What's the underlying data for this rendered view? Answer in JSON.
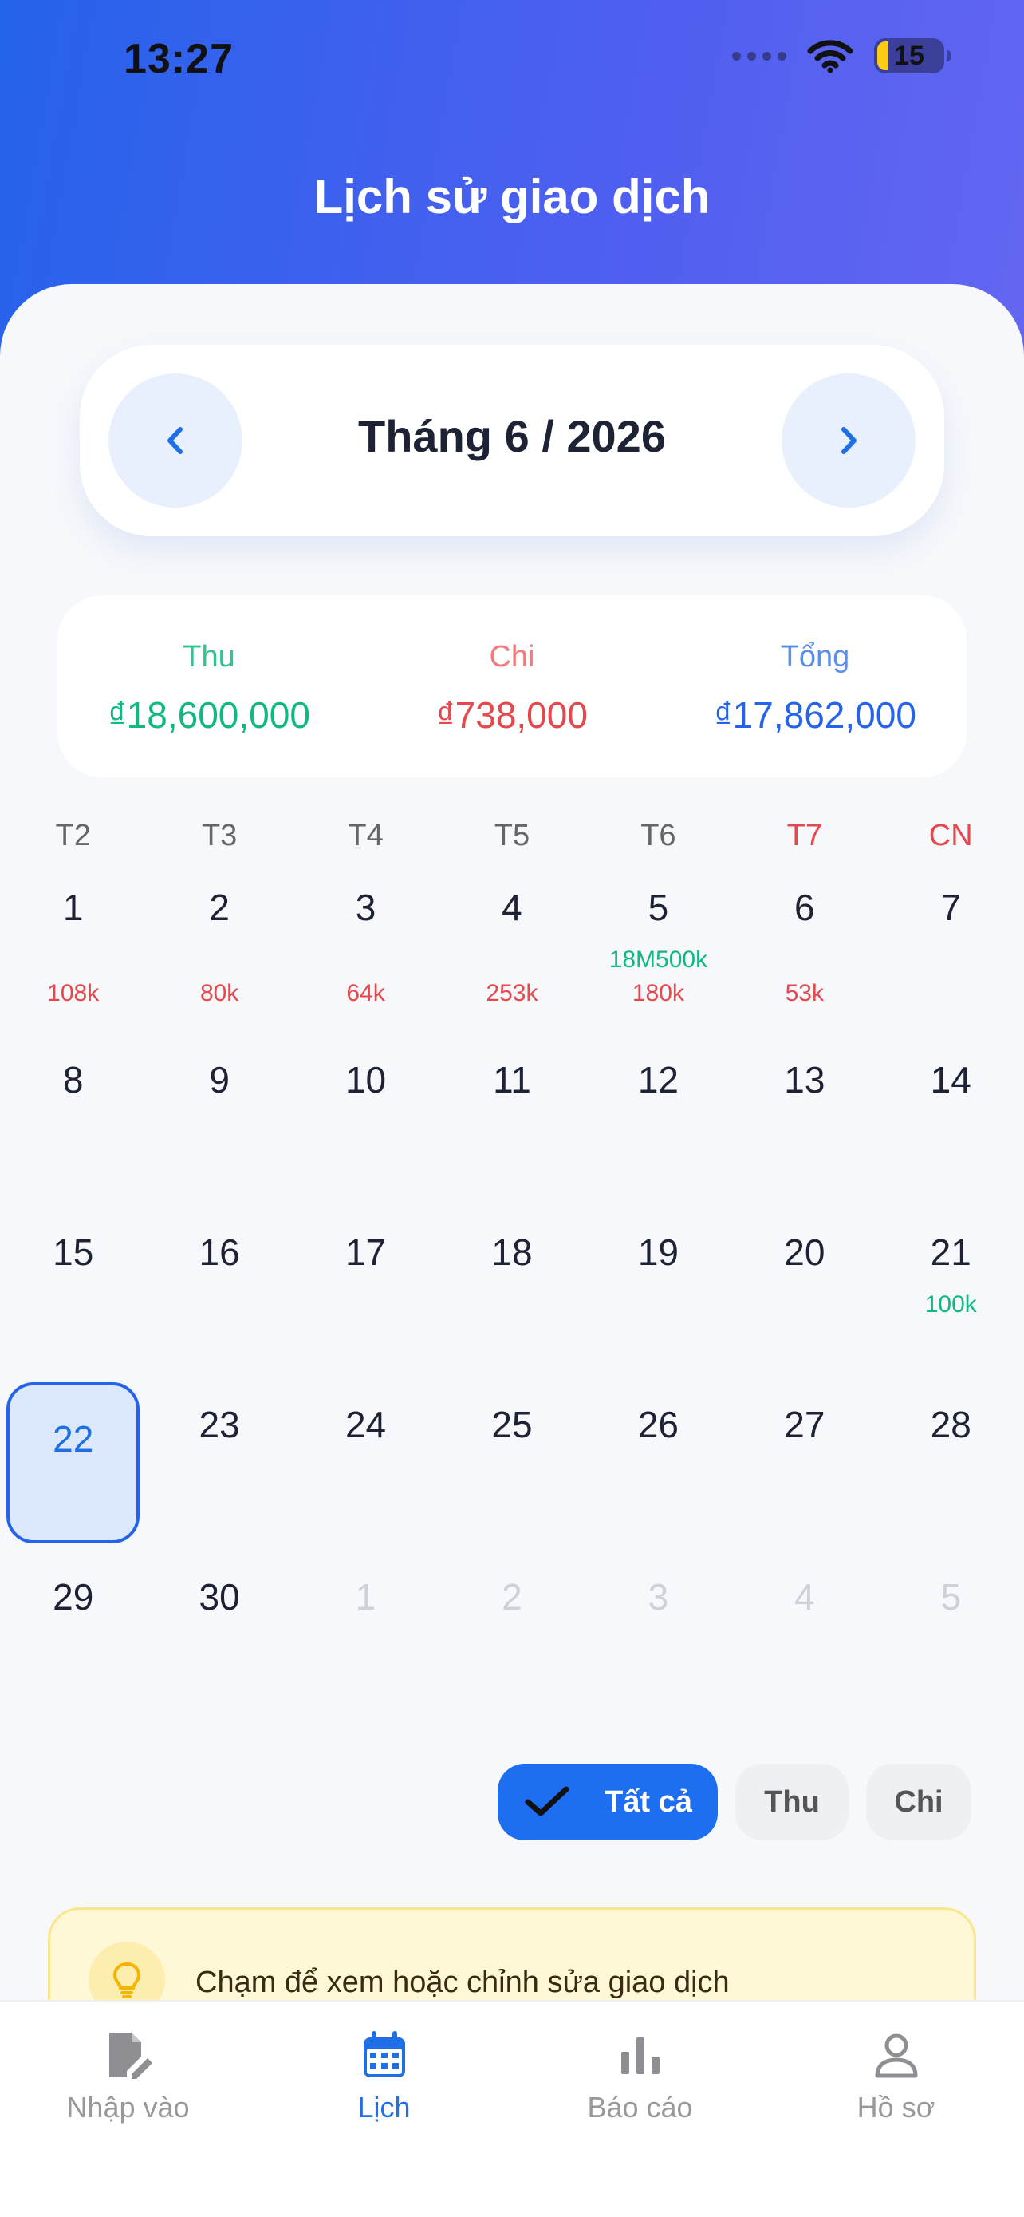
{
  "status": {
    "time": "13:27",
    "battery": "15"
  },
  "header": {
    "title": "Lịch sử giao dịch"
  },
  "month": {
    "label": "Tháng 6 / 2026"
  },
  "summary": {
    "income": {
      "label": "Thu",
      "value": "₫18,600,000",
      "color": "#10b981"
    },
    "expense": {
      "label": "Chi",
      "value": "₫738,000",
      "color": "#e5484d"
    },
    "total": {
      "label": "Tổng",
      "value": "₫17,862,000",
      "color": "#2563eb"
    }
  },
  "weekdays": [
    "T2",
    "T3",
    "T4",
    "T5",
    "T6",
    "T7",
    "CN"
  ],
  "calendar": {
    "weeks": [
      [
        {
          "day": "1",
          "exp": "108k"
        },
        {
          "day": "2",
          "exp": "80k"
        },
        {
          "day": "3",
          "exp": "64k"
        },
        {
          "day": "4",
          "exp": "253k"
        },
        {
          "day": "5",
          "inc": "18M500k",
          "exp": "180k"
        },
        {
          "day": "6",
          "exp": "53k"
        },
        {
          "day": "7"
        }
      ],
      [
        {
          "day": "8"
        },
        {
          "day": "9"
        },
        {
          "day": "10"
        },
        {
          "day": "11"
        },
        {
          "day": "12"
        },
        {
          "day": "13"
        },
        {
          "day": "14"
        }
      ],
      [
        {
          "day": "15"
        },
        {
          "day": "16"
        },
        {
          "day": "17"
        },
        {
          "day": "18"
        },
        {
          "day": "19"
        },
        {
          "day": "20"
        },
        {
          "day": "21",
          "inc": "100k"
        }
      ],
      [
        {
          "day": "22",
          "today": true
        },
        {
          "day": "23"
        },
        {
          "day": "24"
        },
        {
          "day": "25"
        },
        {
          "day": "26"
        },
        {
          "day": "27"
        },
        {
          "day": "28"
        }
      ],
      [
        {
          "day": "29"
        },
        {
          "day": "30"
        },
        {
          "day": "1",
          "muted": true
        },
        {
          "day": "2",
          "muted": true
        },
        {
          "day": "3",
          "muted": true
        },
        {
          "day": "4",
          "muted": true
        },
        {
          "day": "5",
          "muted": true
        }
      ]
    ]
  },
  "filters": {
    "all": "Tất cả",
    "income": "Thu",
    "expense": "Chi"
  },
  "hint": {
    "text": "Chạm để xem hoặc chỉnh sửa giao dịch"
  },
  "tabs": [
    {
      "label": "Nhập vào",
      "icon": "edit-document-icon"
    },
    {
      "label": "Lịch",
      "icon": "calendar-icon",
      "active": true
    },
    {
      "label": "Báo cáo",
      "icon": "bar-chart-icon"
    },
    {
      "label": "Hồ sơ",
      "icon": "user-profile-icon"
    }
  ]
}
